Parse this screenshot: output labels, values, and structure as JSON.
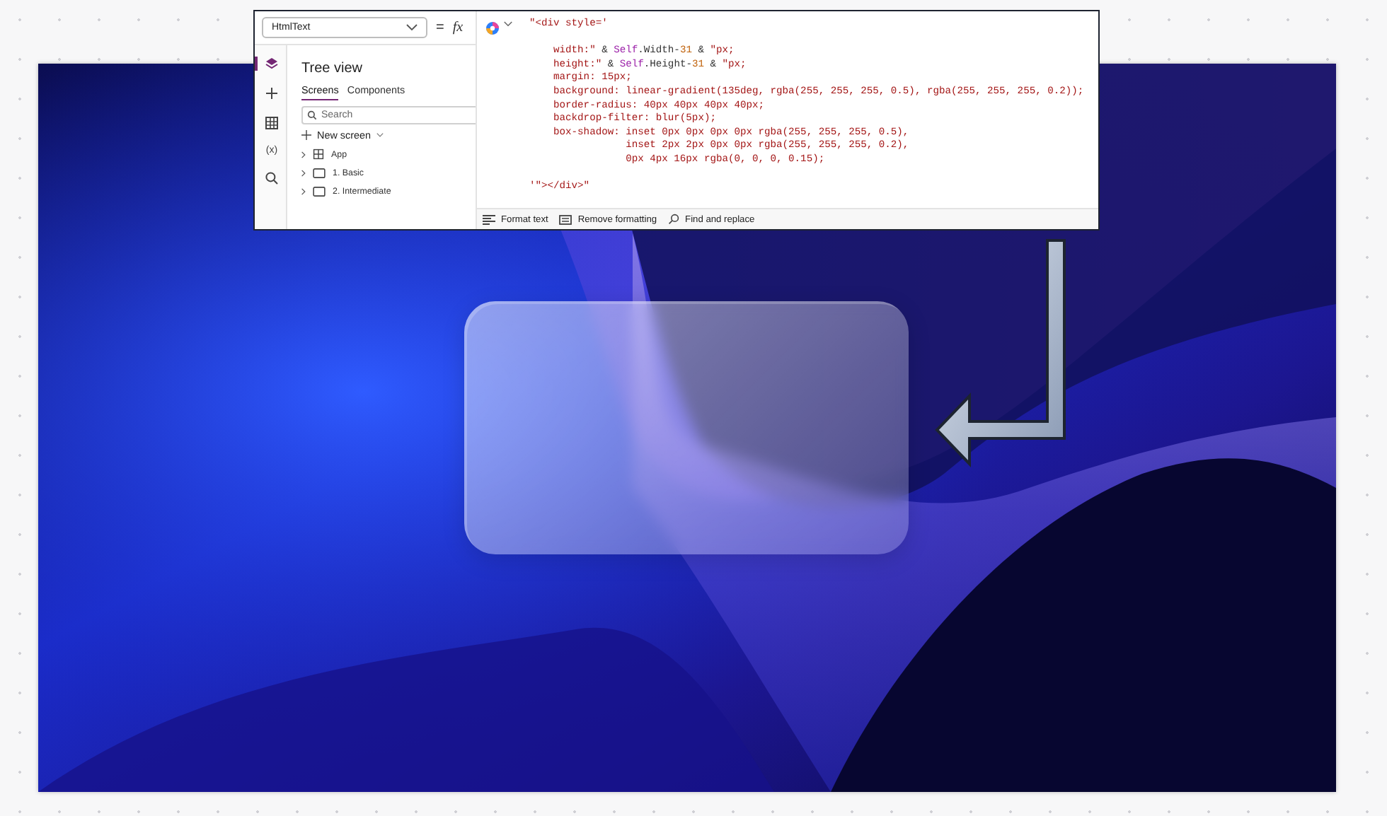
{
  "editor": {
    "formula_bar": {
      "property": "HtmlText",
      "equals": "=",
      "fx": "fx"
    },
    "rail": [
      {
        "kind": "layers",
        "selected": true
      },
      {
        "kind": "plus",
        "selected": false
      },
      {
        "kind": "table",
        "selected": false
      },
      {
        "kind": "variables",
        "glyph": "(x)",
        "selected": false
      },
      {
        "kind": "search",
        "selected": false
      }
    ],
    "tree_view": {
      "title": "Tree view",
      "tabs": [
        {
          "label": "Screens",
          "selected": true
        },
        {
          "label": "Components",
          "selected": false
        }
      ],
      "search": {
        "placeholder": "Search"
      },
      "new_screen": "New screen",
      "items": [
        {
          "label": "App",
          "kind": "app"
        },
        {
          "label": "1. Basic",
          "kind": "screen"
        },
        {
          "label": "2. Intermediate",
          "kind": "screen"
        }
      ]
    },
    "code_lines": [
      {
        "gap_before": false,
        "tokens": [
          {
            "text": "\"<div style='",
            "kind": "str"
          }
        ]
      },
      {
        "gap_before": true,
        "tokens": [
          {
            "text": "    width:\"",
            "kind": "str"
          },
          {
            "text": " & ",
            "kind": "plain"
          },
          {
            "text": "Self",
            "kind": "ident"
          },
          {
            "text": ".Width-",
            "kind": "plain"
          },
          {
            "text": "31",
            "kind": "num"
          },
          {
            "text": " & ",
            "kind": "plain"
          },
          {
            "text": "\"px;",
            "kind": "str"
          }
        ]
      },
      {
        "gap_before": false,
        "tokens": [
          {
            "text": "    height:\"",
            "kind": "str"
          },
          {
            "text": " & ",
            "kind": "plain"
          },
          {
            "text": "Self",
            "kind": "ident"
          },
          {
            "text": ".Height-",
            "kind": "plain"
          },
          {
            "text": "31",
            "kind": "num"
          },
          {
            "text": " & ",
            "kind": "plain"
          },
          {
            "text": "\"px;",
            "kind": "str"
          }
        ]
      },
      {
        "gap_before": false,
        "tokens": [
          {
            "text": "    margin: 15px;",
            "kind": "str"
          }
        ]
      },
      {
        "gap_before": false,
        "tokens": [
          {
            "text": "    background: linear-gradient(135deg, rgba(255, 255, 255, 0.5), rgba(255, 255, 255, 0.2));",
            "kind": "str"
          }
        ]
      },
      {
        "gap_before": false,
        "tokens": [
          {
            "text": "    border-radius: 40px 40px 40px 40px;",
            "kind": "str"
          }
        ]
      },
      {
        "gap_before": false,
        "tokens": [
          {
            "text": "    backdrop-filter: blur(5px);",
            "kind": "str"
          }
        ]
      },
      {
        "gap_before": false,
        "tokens": [
          {
            "text": "    box-shadow: inset 0px 0px 0px 0px rgba(255, 255, 255, 0.5),",
            "kind": "str"
          }
        ]
      },
      {
        "gap_before": false,
        "tokens": [
          {
            "text": "                inset 2px 2px 0px 0px rgba(255, 255, 255, 0.2),",
            "kind": "str"
          }
        ]
      },
      {
        "gap_before": false,
        "tokens": [
          {
            "text": "                0px 4px 16px rgba(0, 0, 0, 0.15);",
            "kind": "str"
          }
        ]
      },
      {
        "gap_before": true,
        "tokens": [
          {
            "text": "'\"></div>\"",
            "kind": "str"
          }
        ]
      }
    ],
    "code_toolbar": [
      {
        "label": "Format text",
        "kind": "format"
      },
      {
        "label": "Remove formatting",
        "kind": "remove"
      },
      {
        "label": "Find and replace",
        "kind": "find"
      }
    ]
  }
}
